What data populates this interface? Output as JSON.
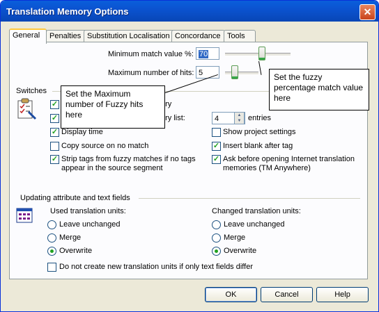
{
  "window": {
    "title": "Translation Memory Options",
    "close_glyph": "✕"
  },
  "tabs": [
    {
      "label": "General",
      "active": true
    },
    {
      "label": "Penalties"
    },
    {
      "label": "Substitution Localisation"
    },
    {
      "label": "Concordance"
    },
    {
      "label": "Tools"
    }
  ],
  "match": {
    "min_label": "Minimum match value %:",
    "min_value": "70",
    "max_label": "Maximum number of hits:",
    "max_value": "5",
    "min_slider_level": 0.7,
    "max_slider_level": 0.05
  },
  "switches": {
    "heading": "Switches",
    "icon": "clipboard-checklist-icon",
    "left": [
      {
        "label": "ory",
        "checked": true
      },
      {
        "label": "ory list:",
        "checked": true
      },
      {
        "label": "Display time",
        "checked": true
      },
      {
        "label": "Copy source on no match",
        "checked": false
      },
      {
        "label": "Strip tags from fuzzy matches if no tags appear in the source segment",
        "line1": "Strip tags from fuzzy matches if no tags",
        "line2": "appear in the source segment",
        "checked": true
      }
    ],
    "entries_value": "4",
    "entries_label": "entries",
    "right": [
      {
        "label": "Show project settings",
        "checked": false
      },
      {
        "label": "Insert blank after tag",
        "checked": true
      },
      {
        "label": "Ask before opening Internet translation memories (TM Anywhere)",
        "line1": "Ask before opening Internet translation",
        "line2": "memories (TM Anywhere)",
        "checked": true
      }
    ]
  },
  "updating": {
    "heading": "Updating attribute and text fields",
    "icon": "grid-table-icon",
    "used_heading": "Used translation units:",
    "changed_heading": "Changed translation units:",
    "options": [
      "Leave unchanged",
      "Merge",
      "Overwrite"
    ],
    "used_selected": "Overwrite",
    "changed_selected": "Overwrite",
    "no_create_label": "Do not create new translation units if only text fields differ",
    "no_create_checked": false
  },
  "annotations": {
    "fuzzy_note": "Set the fuzzy percentage match value here",
    "hits_note": "Set the Maximum number of Fuzzy hits here"
  },
  "buttons": {
    "ok": "OK",
    "cancel": "Cancel",
    "help": "Help"
  },
  "colors": {
    "title_bar": "#0a5fdb",
    "check_green": "#21a121",
    "face": "#ece9d8"
  }
}
